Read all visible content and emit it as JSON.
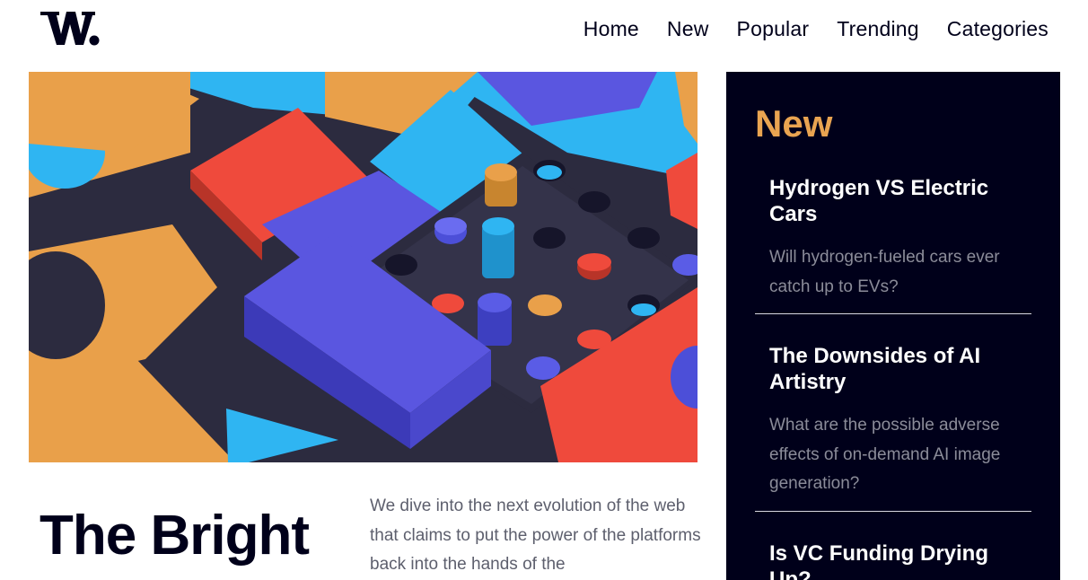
{
  "brand": {
    "logo_text": "W."
  },
  "nav": {
    "items": [
      "Home",
      "New",
      "Popular",
      "Trending",
      "Categories"
    ]
  },
  "hero": {
    "image_icon": "abstract-blocks-illustration",
    "colors": [
      "#e9a04a",
      "#2fb5f2",
      "#4c4fd8",
      "#ef4a3c",
      "#2c2b3f"
    ]
  },
  "article": {
    "title": "The Bright",
    "lead": "We dive into the next evolution of the web that claims to put the power of the platforms back into the hands of the"
  },
  "sidebar": {
    "title": "New",
    "items": [
      {
        "title": "Hydrogen VS Electric Cars",
        "summary": "Will hydrogen-fueled cars ever catch up to EVs?"
      },
      {
        "title": "The Downsides of AI Artistry",
        "summary": "What are the possible adverse effects of on-demand AI image generation?"
      },
      {
        "title": "Is VC Funding Drying Up?",
        "summary": ""
      }
    ]
  },
  "colors": {
    "dark": "#00001a",
    "accent": "#e9a451",
    "muted_text": "#5d5f6d"
  }
}
